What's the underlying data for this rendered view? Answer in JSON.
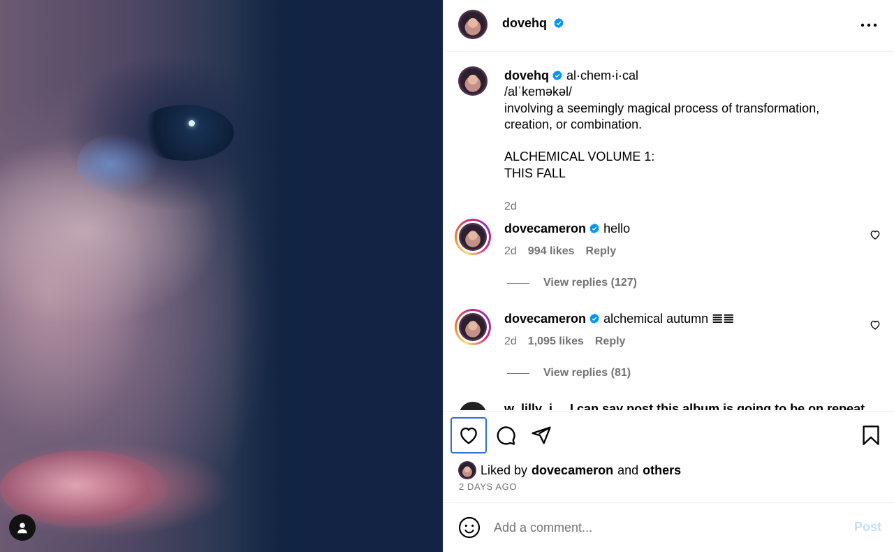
{
  "post": {
    "author": "dovehq",
    "caption_word": "al·chem·i·cal",
    "caption_text": "/alˈkeməkəl/\ninvolving a seemingly magical process of transformation, creation, or combination.\n\nALCHEMICAL VOLUME 1:\nTHIS FALL",
    "caption_time": "2d"
  },
  "comments": [
    {
      "user": "dovecameron",
      "text": "hello",
      "time": "2d",
      "likes": "994 likes",
      "reply": "Reply",
      "view_replies": "View replies (127)"
    },
    {
      "user": "dovecameron",
      "text": "alchemical autumn 𝌆𝌆",
      "time": "2d",
      "likes": "1,095 likes",
      "reply": "Reply",
      "view_replies": "View replies (81)"
    }
  ],
  "partial_comment": "w_lilly_i   ...   I can say post this album is going to be on repeat",
  "liked_by": {
    "prefix": "Liked by",
    "user": "dovecameron",
    "and": "and",
    "others": "others"
  },
  "timestamp": "2 DAYS AGO",
  "add_comment": {
    "placeholder": "Add a comment...",
    "post_label": "Post"
  },
  "colors": {
    "accent": "#0095f6",
    "muted": "#737373",
    "post_disabled": "#c0dffd",
    "focus": "#2f6fd3"
  },
  "icons": [
    "verified-icon",
    "more-icon",
    "heart-icon",
    "comment-icon",
    "share-icon",
    "save-icon",
    "emoji-icon",
    "profile-icon"
  ]
}
